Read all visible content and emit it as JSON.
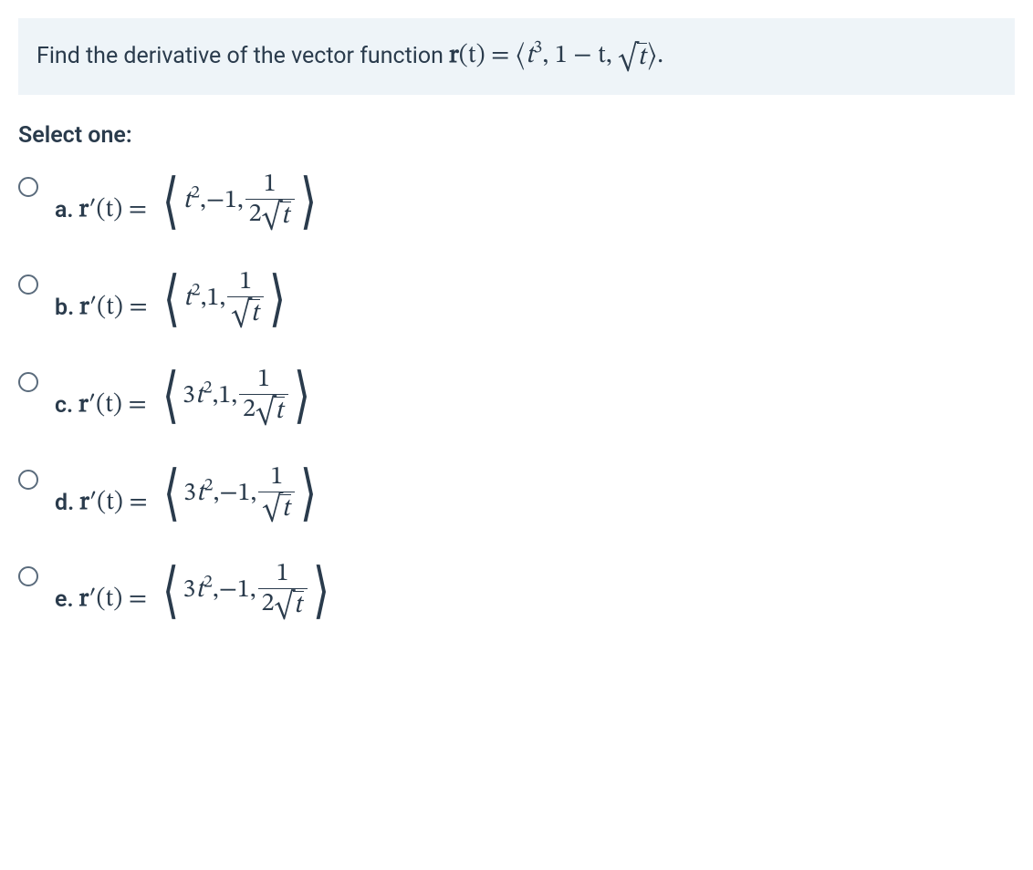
{
  "question": {
    "prefix_text": "Find the derivative of the vector function ",
    "func_bold": "r",
    "func_arg": "(t) = ",
    "open": "⟨",
    "term1_base": "t",
    "term1_sup": "3",
    "sep": ", ",
    "term2": "1 − t",
    "term3_sqrt_arg": "t",
    "close": "⟩",
    "period": "."
  },
  "select_label": "Select one:",
  "options": [
    {
      "letter": "a.",
      "lhs_bold": "r",
      "lhs_rest": "′(t) = ",
      "open": "⟨",
      "t1_coef": "",
      "t1_base": "t",
      "t1_sup": "2",
      "t2": "−1",
      "frac_num": "1",
      "frac_den_coef": "2",
      "frac_den_sqrt_arg": "t",
      "close": "⟩"
    },
    {
      "letter": "b.",
      "lhs_bold": "r",
      "lhs_rest": "′(t) = ",
      "open": "⟨",
      "t1_coef": "",
      "t1_base": "t",
      "t1_sup": "2",
      "t2": "1",
      "frac_num": "1",
      "frac_den_coef": "",
      "frac_den_sqrt_arg": "t",
      "close": "⟩"
    },
    {
      "letter": "c.",
      "lhs_bold": "r",
      "lhs_rest": "′(t) = ",
      "open": "⟨",
      "t1_coef": "3",
      "t1_base": "t",
      "t1_sup": "2",
      "t2": "1",
      "frac_num": "1",
      "frac_den_coef": "2",
      "frac_den_sqrt_arg": "t",
      "close": "⟩"
    },
    {
      "letter": "d.",
      "lhs_bold": "r",
      "lhs_rest": "′(t) = ",
      "open": "⟨",
      "t1_coef": "3",
      "t1_base": "t",
      "t1_sup": "2",
      "t2": "−1",
      "frac_num": "1",
      "frac_den_coef": "",
      "frac_den_sqrt_arg": "t",
      "close": "⟩"
    },
    {
      "letter": "e.",
      "lhs_bold": "r",
      "lhs_rest": "′(t) = ",
      "open": "⟨",
      "t1_coef": "3",
      "t1_base": "t",
      "t1_sup": "2",
      "t2": "−1",
      "frac_num": "1",
      "frac_den_coef": "2",
      "frac_den_sqrt_arg": "t",
      "close": "⟩"
    }
  ]
}
